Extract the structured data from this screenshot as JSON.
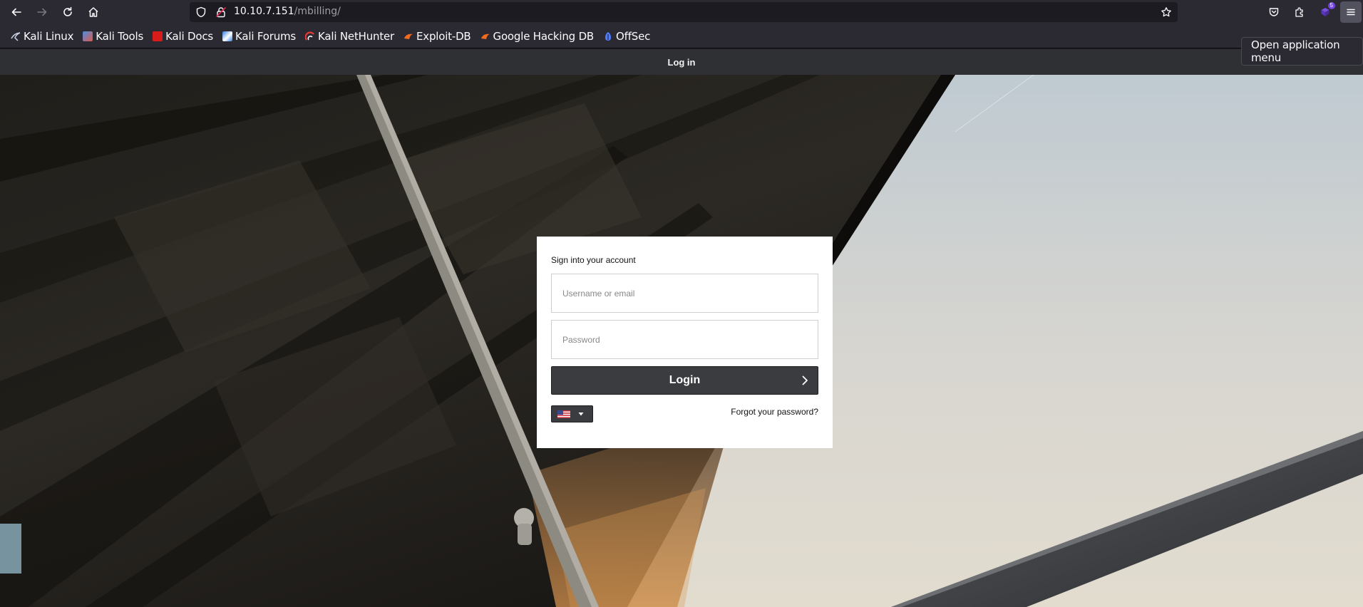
{
  "browser": {
    "url_host": "10.10.7.151",
    "url_path": "/mbilling/",
    "extension_badge": "5",
    "menu_tooltip": "Open application menu",
    "bookmarks": [
      {
        "label": "Kali Linux",
        "icon": "kali-linux-icon",
        "color": "#8ab4f8"
      },
      {
        "label": "Kali Tools",
        "icon": "kali-tools-icon",
        "color": "#e0584d"
      },
      {
        "label": "Kali Docs",
        "icon": "kali-docs-icon",
        "color": "#d81b1b"
      },
      {
        "label": "Kali Forums",
        "icon": "kali-forums-icon",
        "color": "#3a8be0"
      },
      {
        "label": "Kali NetHunter",
        "icon": "kali-nethunter-icon",
        "color": "#e53935"
      },
      {
        "label": "Exploit-DB",
        "icon": "exploit-db-icon",
        "color": "#f26b1d"
      },
      {
        "label": "Google Hacking DB",
        "icon": "google-hacking-db-icon",
        "color": "#f26b1d"
      },
      {
        "label": "OffSec",
        "icon": "offsec-icon",
        "color": "#4f7cff"
      }
    ]
  },
  "page": {
    "header_title": "Log in"
  },
  "login": {
    "title": "Sign into your account",
    "username_placeholder": "Username or email",
    "username_value": "",
    "password_placeholder": "Password",
    "password_value": "",
    "login_label": "Login",
    "forgot_label": "Forgot your password?",
    "language": "en-US"
  },
  "colors": {
    "header_bg": "#2f3033",
    "button_bg": "#3b3c3f",
    "browser_bg": "#2b2a33"
  }
}
